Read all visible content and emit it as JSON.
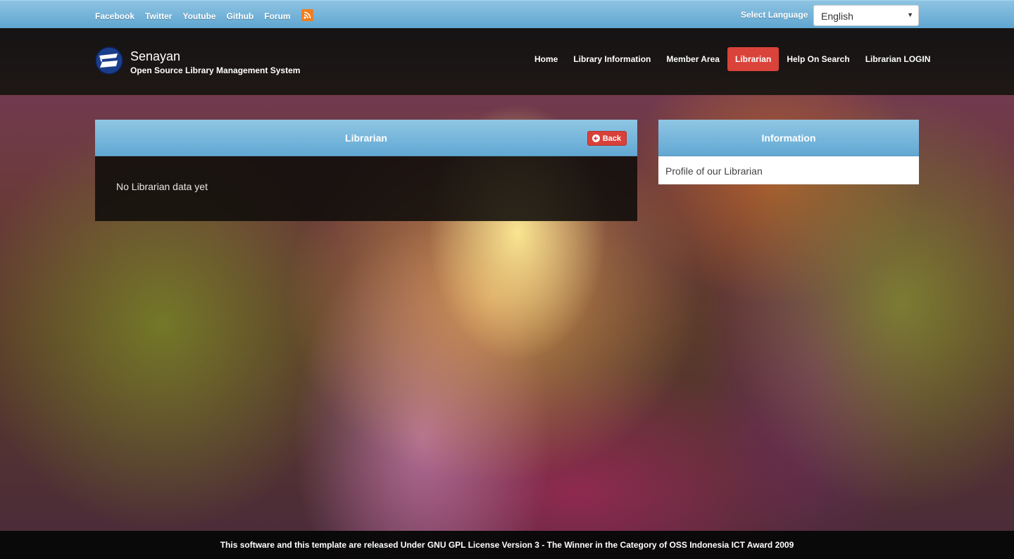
{
  "topbar": {
    "social_links": [
      "Facebook",
      "Twitter",
      "Youtube",
      "Github",
      "Forum"
    ],
    "rss_icon": "rss-icon",
    "language_label": "Select Language",
    "language_selected": "English"
  },
  "header": {
    "brand_name": "Senayan",
    "brand_subtitle": "Open Source Library Management System",
    "logo_icon": "senayan-logo-icon",
    "nav": [
      "Home",
      "Library Information",
      "Member Area",
      "Librarian",
      "Help On Search",
      "Librarian LOGIN"
    ],
    "active_nav": "Librarian"
  },
  "main_panel": {
    "title": "Librarian",
    "back_label": "Back",
    "message": "No Librarian data yet"
  },
  "side_panel": {
    "title": "Information",
    "link": "Profile of our Librarian"
  },
  "footer": {
    "text": "This software and this template are released Under GNU GPL License Version 3 - The Winner in the Category of OSS Indonesia ICT Award 2009"
  },
  "colors": {
    "topbar": "#5fa6d1",
    "active_nav": "#d9433a",
    "back_button": "#d8413a",
    "rss": "#f07e1e"
  }
}
